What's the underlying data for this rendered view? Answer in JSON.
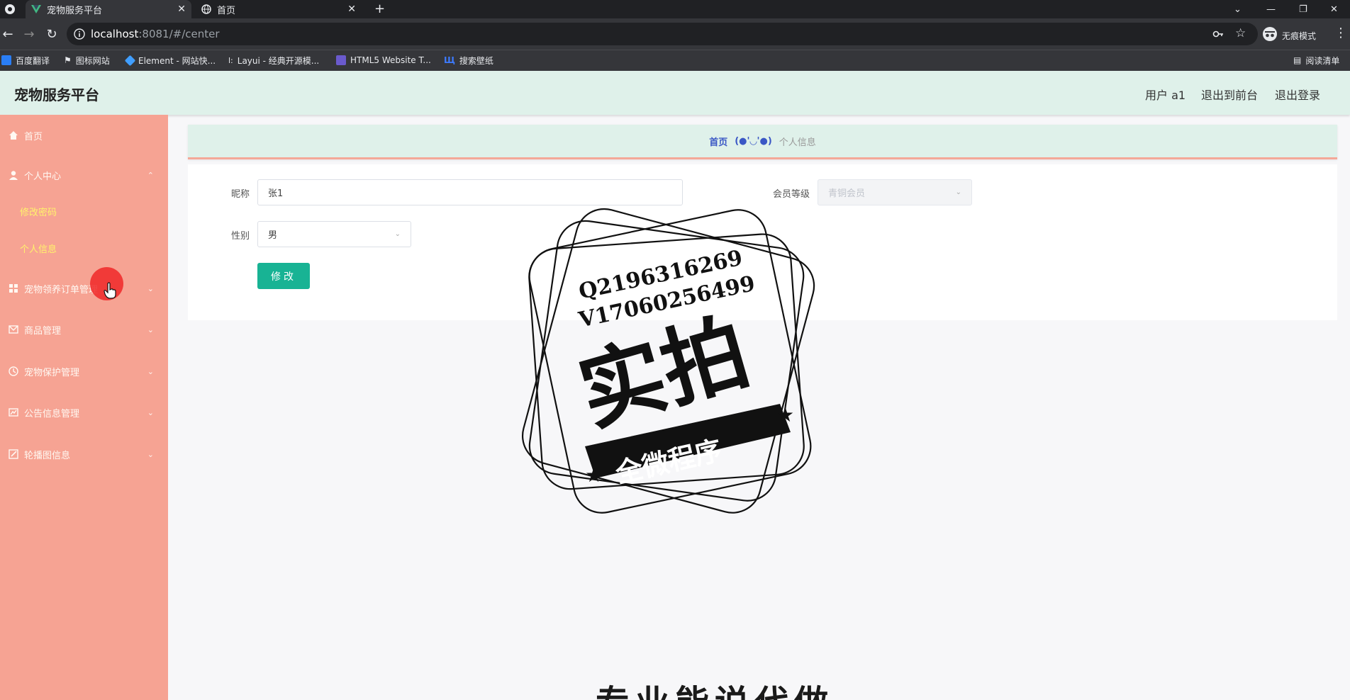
{
  "browser": {
    "tabs": [
      {
        "title": "宠物服务平台",
        "active": true
      },
      {
        "title": "首页",
        "active": false
      }
    ],
    "new_tab": "+",
    "url_host": "localhost",
    "url_path": ":8081/#/center",
    "profile_label": "无痕模式",
    "reading_list": "阅读清单",
    "bookmarks": [
      {
        "label": "百度翻译",
        "color": "#2a7ef5"
      },
      {
        "label": "图标网站",
        "color": "#ffffff"
      },
      {
        "label": "Element - 网站快...",
        "color": "#409eff"
      },
      {
        "label": "Layui - 经典开源模...",
        "color": "#999999"
      },
      {
        "label": "HTML5 Website T...",
        "color": "#6a5acd"
      },
      {
        "label": "搜索壁纸",
        "color": "#3d7bff"
      }
    ]
  },
  "header": {
    "title": "宠物服务平台",
    "user": "用户 a1",
    "back_front": "退出到前台",
    "logout": "退出登录"
  },
  "sidebar": {
    "home": "首页",
    "personal_center": "个人中心",
    "sub_change_password": "修改密码",
    "sub_personal_info": "个人信息",
    "items": [
      {
        "label": "宠物领养订单管理"
      },
      {
        "label": "商品管理"
      },
      {
        "label": "宠物保护管理"
      },
      {
        "label": "公告信息管理"
      },
      {
        "label": "轮播图信息"
      }
    ]
  },
  "breadcrumb": {
    "home": "首页",
    "face": "(●'◡'●)",
    "current": "个人信息"
  },
  "form": {
    "nickname_label": "昵称",
    "nickname_value": "张1",
    "level_label": "会员等级",
    "level_value": "青铜会员",
    "gender_label": "性别",
    "gender_value": "男",
    "submit": "修改"
  },
  "watermark": {
    "line1": "Q2196316269",
    "line2": "V17060256499",
    "main": "实拍",
    "ribbon": "全微程序",
    "bottom": "专业能说代做"
  },
  "colors": {
    "sidebar": "#f6a393",
    "header": "#dff1ea",
    "accent_button": "#18b394",
    "submenu_text": "#fff36b"
  }
}
